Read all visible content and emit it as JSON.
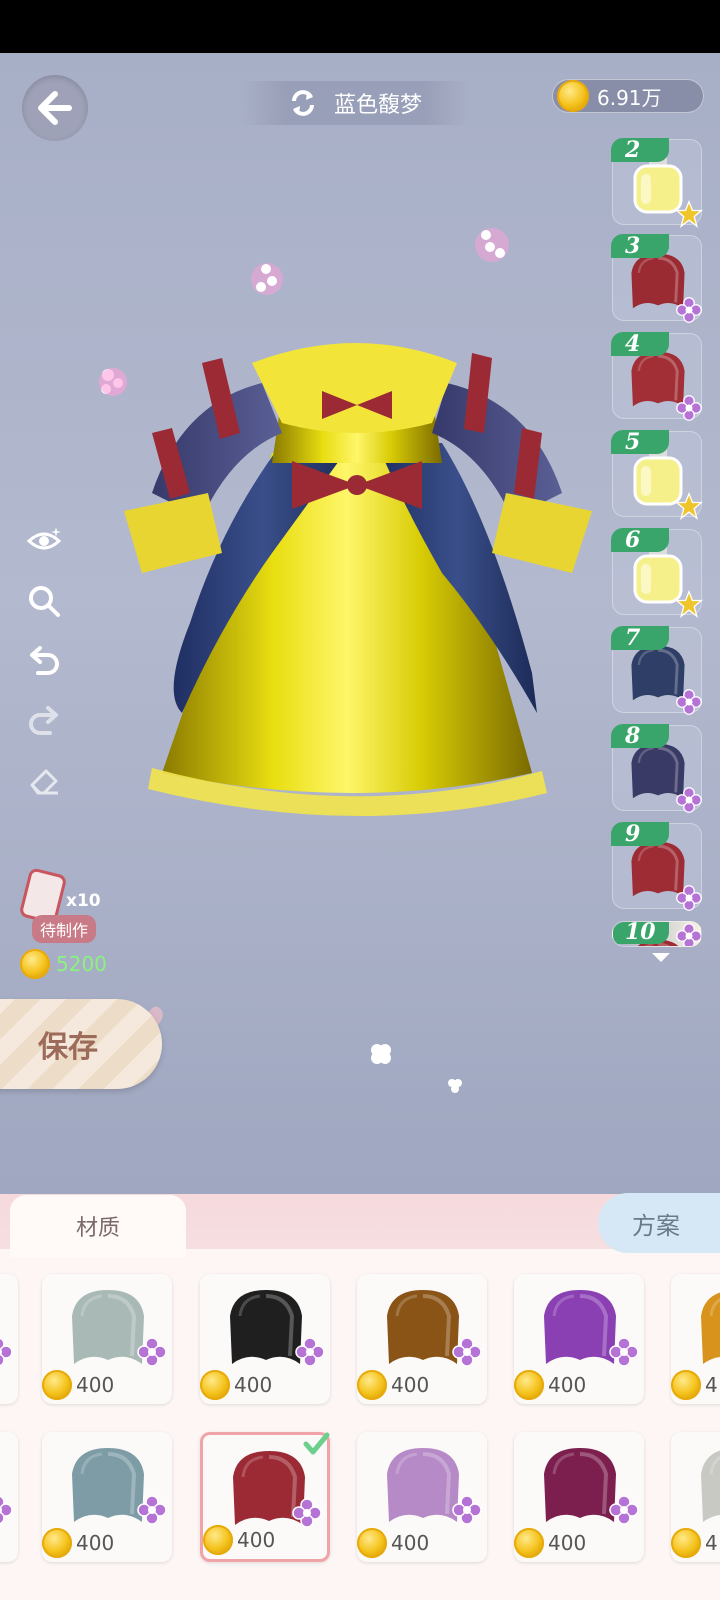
{
  "header": {
    "title": "蓝色馥梦",
    "coins": "6.91万"
  },
  "left_tools": [
    {
      "name": "eye-toggle",
      "icon": "eye-sparkle-icon"
    },
    {
      "name": "zoom",
      "icon": "magnifier-icon"
    },
    {
      "name": "undo",
      "icon": "undo-icon"
    },
    {
      "name": "redo",
      "icon": "redo-icon"
    },
    {
      "name": "eraser",
      "icon": "eraser-icon"
    }
  ],
  "pending": {
    "count": "x10",
    "label": "待制作"
  },
  "cost": "5200",
  "save_label": "保存",
  "steps": [
    {
      "num": "2",
      "type": "perfume",
      "badge": "star"
    },
    {
      "num": "3",
      "type": "fabric",
      "color": "#9b2b33",
      "badge": "flower"
    },
    {
      "num": "4",
      "type": "fabric",
      "color": "#a22e36",
      "badge": "flower"
    },
    {
      "num": "5",
      "type": "perfume",
      "badge": "star"
    },
    {
      "num": "6",
      "type": "perfume",
      "badge": "star"
    },
    {
      "num": "7",
      "type": "fabric",
      "color": "#2e3e66",
      "badge": "flower"
    },
    {
      "num": "8",
      "type": "fabric",
      "color": "#3a3a66",
      "badge": "flower"
    },
    {
      "num": "9",
      "type": "fabric",
      "color": "#9e2c35",
      "badge": "flower"
    },
    {
      "num": "10",
      "type": "fabric",
      "color": "#9e2c35",
      "badge": "flower"
    }
  ],
  "tabs": {
    "material": "材质",
    "plan": "方案"
  },
  "materials_row1": [
    {
      "color": "#a9b9b6",
      "price": "400"
    },
    {
      "color": "#1f1f1f",
      "price": "400"
    },
    {
      "color": "#8a5417",
      "price": "400"
    },
    {
      "color": "#8a3fb3",
      "price": "400"
    },
    {
      "color": "#d7931c",
      "price": "4"
    }
  ],
  "materials_row2": [
    {
      "color": "#7d9ca6",
      "price": "400"
    },
    {
      "color": "#9b2a35",
      "price": "400",
      "selected": true
    },
    {
      "color": "#b68ac6",
      "price": "400"
    },
    {
      "color": "#7c1f4e",
      "price": "400"
    },
    {
      "color": "#c9c9c4",
      "price": "4"
    }
  ]
}
